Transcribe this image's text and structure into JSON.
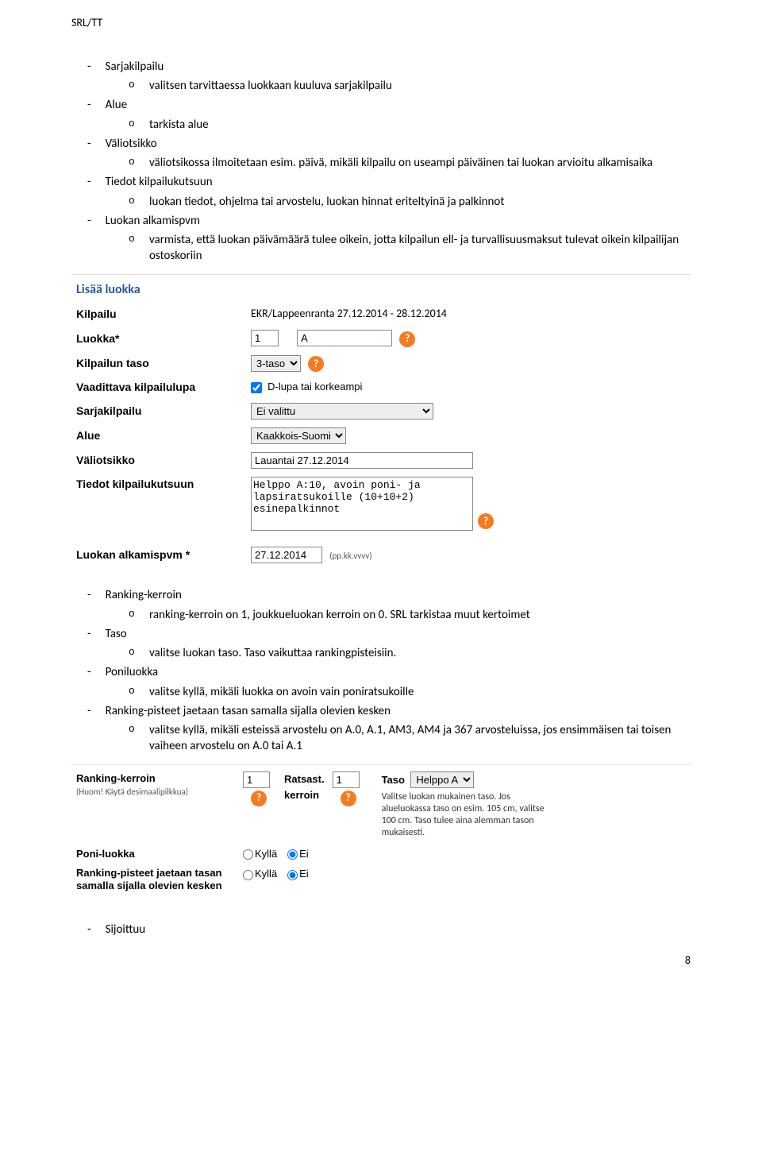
{
  "header": {
    "code": "SRL/TT"
  },
  "list1": {
    "sarjakilpailu": "Sarjakilpailu",
    "sarjakilpailu_sub": "valitsen tarvittaessa luokkaan kuuluva sarjakilpailu",
    "alue": "Alue",
    "alue_sub": "tarkista alue",
    "valiotsikko": "Väliotsikko",
    "valiotsikko_sub": "väliotsikossa ilmoitetaan esim. päivä, mikäli kilpailu on useampi päiväinen tai luokan arvioitu alkamisaika",
    "tiedot": "Tiedot kilpailukutsuun",
    "tiedot_sub": "luokan tiedot, ohjelma tai arvostelu, luokan hinnat eriteltyinä ja palkinnot",
    "luokan_alk": "Luokan alkamispvm",
    "luokan_alk_sub": "varmista, että luokan päivämäärä tulee oikein, jotta kilpailun ell- ja turvallisuusmaksut tulevat oikein kilpailijan ostoskoriin"
  },
  "form": {
    "title": "Lisää luokka",
    "kilpailu_label": "Kilpailu",
    "kilpailu_value": "EKR/Lappeenranta 27.12.2014 - 28.12.2014",
    "luokka_label": "Luokka*",
    "luokka_num": "1",
    "luokka_a": "A",
    "taso_label": "Kilpailun taso",
    "taso_value": "3-taso",
    "vaadittava_label": "Vaadittava kilpailulupa",
    "vaadittava_text": "D-lupa tai korkeampi",
    "sarja_label": "Sarjakilpailu",
    "sarja_value": "Ei valittu",
    "alue_label": "Alue",
    "alue_value": "Kaakkois-Suomi",
    "vali_label": "Väliotsikko",
    "vali_value": "Lauantai 27.12.2014",
    "tiedot_label": "Tiedot kilpailukutsuun",
    "tiedot_value": "Helppo A:10, avoin poni- ja lapsiratsukoille (10+10+2) esinepalkinnot",
    "alkpvm_label": "Luokan alkamispvm *",
    "alkpvm_value": "27.12.2014",
    "alkpvm_hint": "(pp.kk.vvvv)"
  },
  "list2": {
    "ranking": "Ranking-kerroin",
    "ranking_sub": "ranking-kerroin on 1, joukkueluokan kerroin on 0. SRL tarkistaa muut kertoimet",
    "taso": "Taso",
    "taso_sub": "valitse luokan taso. Taso vaikuttaa rankingpisteisiin.",
    "poni": "Poniluokka",
    "poni_sub": "valitse kyllä, mikäli luokka on avoin vain poniratsukoille",
    "rank_pisteet": "Ranking-pisteet jaetaan tasan samalla sijalla olevien kesken",
    "rank_pisteet_sub": "valitse kyllä, mikäli esteissä arvostelu on A.0, A.1, AM3, AM4 ja 367 arvosteluissa, jos ensimmäisen tai toisen vaiheen arvostelu on A.0 tai A.1"
  },
  "form2": {
    "ranking_label": "Ranking-kerroin",
    "ranking_hint": "(Huom! Käytä desimaalipilkkua)",
    "ranking_val": "1",
    "ratsast_label": "Ratsast. kerroin",
    "ratsast_val": "1",
    "taso_label": "Taso",
    "taso_val": "Helppo A",
    "taso_hint": "Valitse luokan mukainen taso. Jos alueluokassa taso on esim. 105 cm, valitse 100 cm. Taso tulee aina alemman tason mukaisesti.",
    "poni_label": "Poni-luokka",
    "rank_split_label": "Ranking-pisteet jaetaan tasan samalla sijalla olevien kesken",
    "kylla": "Kyllä",
    "ei": "Ei"
  },
  "list3": {
    "sijoittuu": "Sijoittuu"
  },
  "page_number": "8"
}
